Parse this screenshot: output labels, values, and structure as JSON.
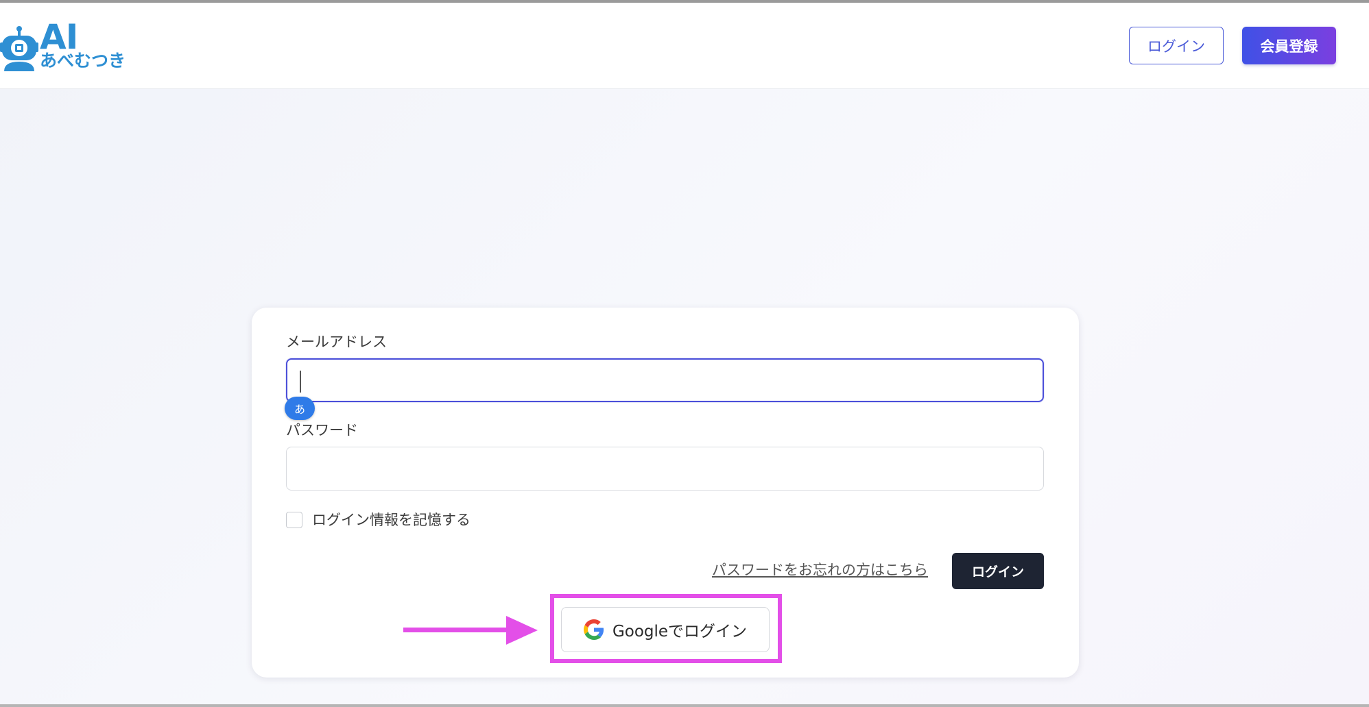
{
  "header": {
    "logo": {
      "main": "AI",
      "sub": "あべむつき"
    },
    "login_label": "ログイン",
    "register_label": "会員登録"
  },
  "form": {
    "email_label": "メールアドレス",
    "email_value": "",
    "ime_indicator": "あ",
    "password_label": "パスワード",
    "password_value": "",
    "remember_label": "ログイン情報を記憶する",
    "remember_checked": false,
    "forgot_link": "パスワードをお忘れの方はこちら",
    "login_button": "ログイン",
    "google_button": "Googleでログイン"
  },
  "colors": {
    "brand": "#2e8fd3",
    "accent": "#4b4fd9",
    "annotation": "#e34fe8"
  }
}
